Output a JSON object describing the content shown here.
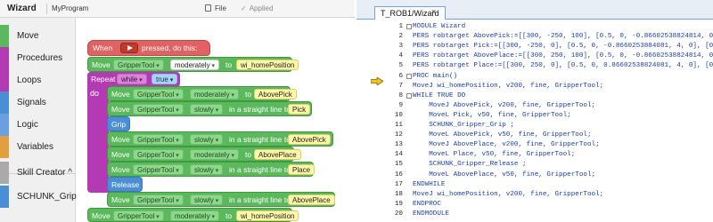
{
  "wizard": {
    "title": "Wizard",
    "program": "MyProgram",
    "file_label": "File",
    "applied_label": "Applied",
    "sidebar": [
      {
        "label": "Move",
        "color": "#5cb85c"
      },
      {
        "label": "Procedures",
        "color": "#b33ab3"
      },
      {
        "label": "Loops",
        "color": "#b33ab3"
      },
      {
        "label": "Signals",
        "color": "#4a8fd6"
      },
      {
        "label": "Logic",
        "color": "#6aa0e0"
      },
      {
        "label": "Variables",
        "color": "#e0a040"
      },
      {
        "label": "Skill Creator ^",
        "color": "#aaaaaa"
      },
      {
        "label": "SCHUNK_Grip",
        "color": "#4a8fd6"
      }
    ],
    "blocks": {
      "when": {
        "pre": "When",
        "post": "pressed, do this:"
      },
      "move_home": {
        "cmd": "Move",
        "tool": "GripperTool",
        "speed": "moderately",
        "to": "to",
        "target": "wi_homePosition"
      },
      "repeat": {
        "label": "Repeat",
        "mode": "while",
        "cond": "true",
        "do": "do"
      },
      "move_abovepick": {
        "cmd": "Move",
        "tool": "GripperTool",
        "speed": "moderately",
        "to": "to",
        "target": "AbovePick"
      },
      "move_pick": {
        "cmd": "Move",
        "tool": "GripperTool",
        "speed": "slowly",
        "to": "in a straight line to",
        "target": "Pick"
      },
      "grip": "Grip",
      "move_abovepick2": {
        "cmd": "Move",
        "tool": "GripperTool",
        "speed": "slowly",
        "to": "in a straight line to",
        "target": "AbovePick"
      },
      "move_aboveplace": {
        "cmd": "Move",
        "tool": "GripperTool",
        "speed": "moderately",
        "to": "to",
        "target": "AbovePlace"
      },
      "move_place": {
        "cmd": "Move",
        "tool": "GripperTool",
        "speed": "slowly",
        "to": "in a straight line to",
        "target": "Place"
      },
      "release": "Release",
      "move_aboveplace2": {
        "cmd": "Move",
        "tool": "GripperTool",
        "speed": "slowly",
        "to": "in a straight line to",
        "target": "AbovePlace"
      },
      "move_home2": {
        "cmd": "Move",
        "tool": "GripperTool",
        "speed": "moderately",
        "to": "to",
        "target": "wi_homePosition"
      }
    }
  },
  "editor": {
    "tab": "T_ROB1/Wizard",
    "close": "×",
    "lines": [
      {
        "n": "1",
        "code": "MODULE Wizard"
      },
      {
        "n": "2",
        "code": "PERS robtarget AbovePick:=[[300, -250, 100], [0.5, 0, -0.86602538824814, 0"
      },
      {
        "n": "3",
        "code": "PERS robtarget Pick:=[[300, -250, 0], [0.5, 0, -0.8660253884081, 4, 0], [0,"
      },
      {
        "n": "4",
        "code": "PERS robtarget AbovePlace:=[[300, 250, 100], [0.5, 0, -0.86602538824814, 0"
      },
      {
        "n": "5",
        "code": "PERS robtarget Place:=[[300, 250, 0], [0.5, 0, 0.86602538824081, 4, 0], [0,"
      },
      {
        "n": "6",
        "code": "PROC main()"
      },
      {
        "n": "7",
        "code": "MoveJ wi_homePosition, v200, fine, GripperTool;"
      },
      {
        "n": "8",
        "code": "WHILE TRUE DO"
      },
      {
        "n": "9",
        "code": "    MoveJ AbovePick, v200, fine, GripperTool;"
      },
      {
        "n": "10",
        "code": "    MoveL Pick, v50, fine, GripperTool;"
      },
      {
        "n": "11",
        "code": "    SCHUNK_Gripper_Grip ;"
      },
      {
        "n": "12",
        "code": "    MoveL AbovePick, v50, fine, GripperTool;"
      },
      {
        "n": "13",
        "code": "    MoveJ AbovePlace, v200, fine, GripperTool;"
      },
      {
        "n": "14",
        "code": "    MoveL Place, v50, fine, GripperTool;"
      },
      {
        "n": "15",
        "code": "    SCHUNK_Gripper_Release ;"
      },
      {
        "n": "16",
        "code": "    MoveL AbovePlace, v50, fine, GripperTool;"
      },
      {
        "n": "17",
        "code": "ENDWHILE"
      },
      {
        "n": "18",
        "code": "MoveJ wi_homePosition, v200, fine, GripperTool;"
      },
      {
        "n": "19",
        "code": "ENDPROC"
      },
      {
        "n": "20",
        "code": "ENDMODULE"
      }
    ]
  },
  "icons": {
    "file": "file-icon",
    "applied": "check-icon",
    "play": "play-button-icon",
    "program_pointer": "program-pointer-arrow-icon",
    "fold": "fold-toggle-icon"
  },
  "colors": {
    "move_block": "#5cb85c",
    "loop_block": "#b33ab3",
    "signal_block": "#4a8fd6",
    "event_block": "#e06262",
    "code_text": "#1d3fa6",
    "program_pointer": "#f0c419"
  }
}
